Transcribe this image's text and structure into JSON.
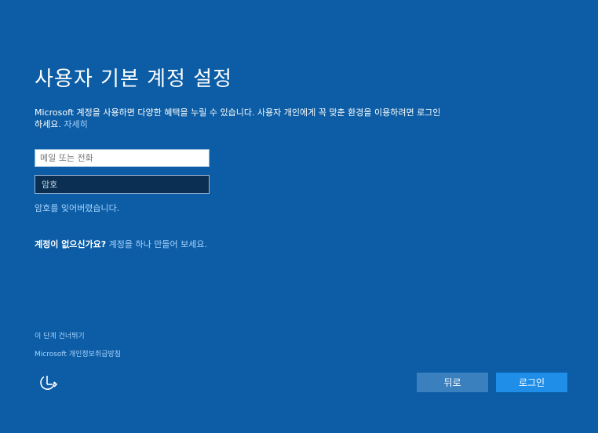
{
  "page": {
    "title": "사용자 기본 계정 설정",
    "description_text": "Microsoft 계정을 사용하면 다양한 혜택을 누릴 수 있습니다. 사용자 개인에게 꼭 맞춘 환경을 이용하려면 로그인하세요.",
    "learn_more_link": "자세히"
  },
  "form": {
    "email_placeholder": "메일 또는 전화",
    "email_value": "",
    "password_placeholder": "암호",
    "password_value": "",
    "forgot_password_link": "암호를 잊어버렸습니다."
  },
  "no_account": {
    "question": "계정이 없으신가요?",
    "create_link": "계정을 하나 만들어 보세요."
  },
  "footer": {
    "skip_link": "이 단계 건너뛰기",
    "privacy_link": "Microsoft 개인정보취급방침",
    "accessibility_icon": "ease-of-access-icon",
    "back_button": "뒤로",
    "login_button": "로그인"
  },
  "colors": {
    "background": "#0c5da5",
    "link": "#a8d4ff",
    "back_button": "#3a7fbe",
    "login_button": "#1e8ee8"
  }
}
